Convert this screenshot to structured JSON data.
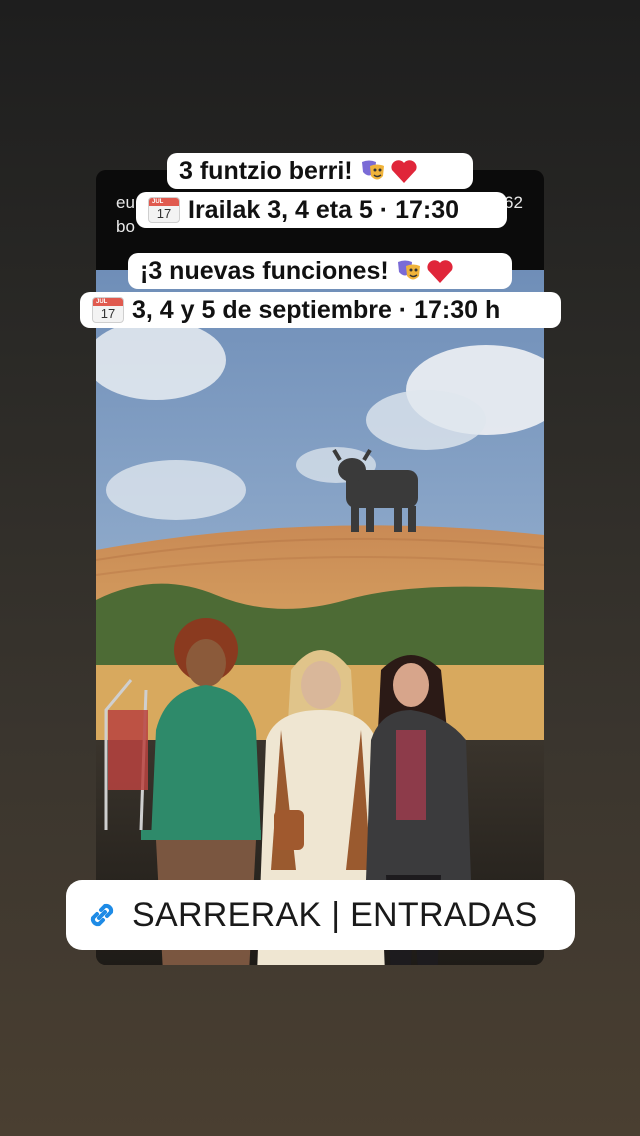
{
  "post_header": {
    "line1_left": "eu",
    "line1_right": "62",
    "line2_left": "bo"
  },
  "captions": {
    "basque_title": "3 funtzio berri!",
    "basque_dates": "Irailak 3, 4 eta 5 · 17:30",
    "spanish_title": "¡3 nuevas funciones!",
    "spanish_dates": "3, 4 y 5 de septiembre · 17:30 h"
  },
  "calendar_icon": {
    "month": "JUL",
    "day": "17"
  },
  "link_sticker": {
    "label": "SARRERAK | ENTRADAS"
  },
  "icons": [
    "calendar-icon",
    "theater-masks-icon",
    "heart-icon",
    "link-icon"
  ],
  "colors": {
    "link_icon": "#1e8be6",
    "heart": "#e0263a",
    "calendar_top": "#e05a4f"
  }
}
